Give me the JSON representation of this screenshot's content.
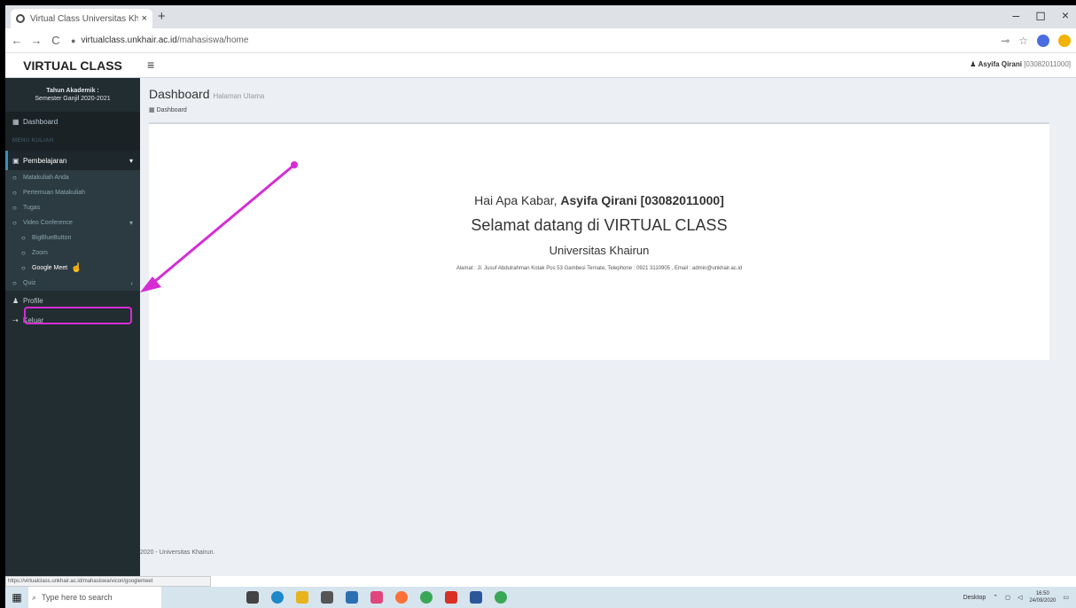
{
  "browser": {
    "tab_title": "Virtual Class Universitas Khairun",
    "tab_close": "×",
    "new_tab": "+",
    "window_controls": [
      "–",
      "◻",
      "×"
    ],
    "url_host": "virtualclass.unkhair.ac.id",
    "url_path": "/mahasiswa/home",
    "nav": {
      "back": "←",
      "forward": "→",
      "reload": "C"
    }
  },
  "topnav": {
    "logo": "VIRTUAL CLASS",
    "menu_icon": "≡",
    "user_name": "Asyifa Qirani",
    "user_nim": "[03082011000]"
  },
  "sidebar": {
    "year_line1": "Tahun Akademik :",
    "year_line2": "Semester Ganjil 2020-2021",
    "dashboard": "Dashboard",
    "menu_header": "MENU KULIAH",
    "pembelajaran": "Pembelajaran",
    "sub": [
      "Matakuliah Anda",
      "Pertemuan Matakuliah",
      "Tugas",
      "Video Conference"
    ],
    "vc_sub": [
      "BigBlueButton",
      "Zoom",
      "Google Meet"
    ],
    "quiz": "Quiz",
    "profile": "Profile",
    "logout": "Keluar"
  },
  "content": {
    "page_title": "Dashboard",
    "page_subtitle": "Halaman Utama",
    "breadcrumb": "Dashboard",
    "greeting_prefix": "Hai Apa Kabar, ",
    "greeting_name": "Asyifa Qirani [03082011000]",
    "welcome": "Selamat datang di VIRTUAL CLASS",
    "university": "Universitas Khairun",
    "address": "Alamat : Jl. Jusuf Abdulrahman Kotak Pos 53 Gambesi Ternate, Telephone : 0921 3110905 , Email : admin@unkhair.ac.id"
  },
  "footer": "2020 - Universitas Khairun.",
  "status_url": "https://virtualclass.unkhair.ac.id/mahasiswa/vicon/googlemeet",
  "taskbar": {
    "search_placeholder": "Type here to search",
    "tray_label": "Desktop",
    "time": "16:50",
    "date": "24/09/2020"
  },
  "colors": {
    "sidebar_bg": "#222d32",
    "annotation": "#d62cd6",
    "accent": "#3c8dbc"
  }
}
